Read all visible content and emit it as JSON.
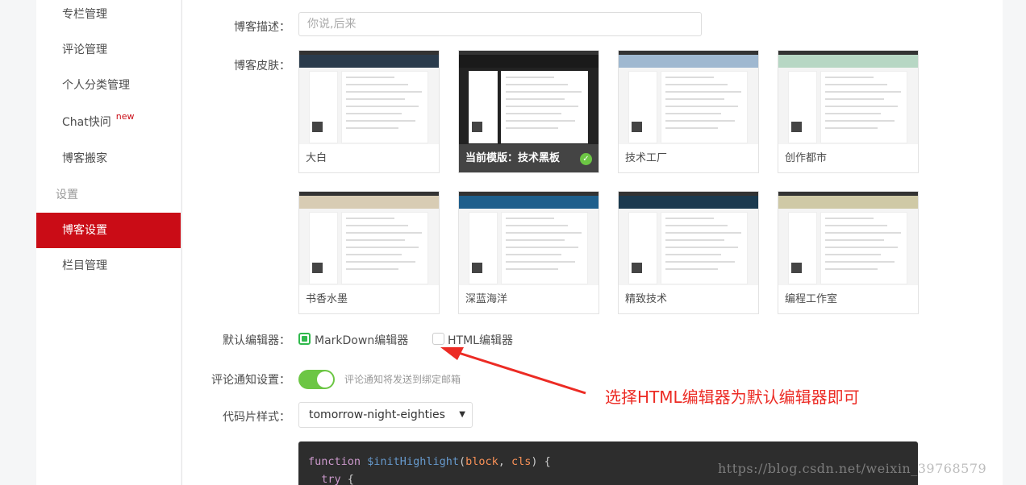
{
  "sidebar": {
    "items": [
      {
        "label": "专栏管理"
      },
      {
        "label": "评论管理"
      },
      {
        "label": "个人分类管理"
      },
      {
        "label": "Chat快问",
        "badge": "new"
      },
      {
        "label": "博客搬家"
      }
    ],
    "settings_heading": "设置",
    "settings_items": [
      {
        "label": "博客设置",
        "active": true
      },
      {
        "label": "栏目管理"
      }
    ]
  },
  "form": {
    "desc_label": "博客描述：",
    "desc_placeholder": "你说,后来",
    "skin_label": "博客皮肤：",
    "skins": [
      {
        "name": "大白",
        "banner": "#2a3b4c"
      },
      {
        "name": "当前模版：技术黑板",
        "banner": "#1a1a1a",
        "current": true
      },
      {
        "name": "技术工厂",
        "banner": "#9fb8d0"
      },
      {
        "name": "创作都市",
        "banner": "#b7d7c4"
      },
      {
        "name": "书香水墨",
        "banner": "#d8ccb4"
      },
      {
        "name": "深蓝海洋",
        "banner": "#1e5f8c"
      },
      {
        "name": "精致技术",
        "banner": "#1b3a4f"
      },
      {
        "name": "编程工作室",
        "banner": "#cfc9a6"
      }
    ],
    "editor_label": "默认编辑器：",
    "editor_markdown": "MarkDown编辑器",
    "editor_html": "HTML编辑器",
    "comment_label": "评论通知设置：",
    "comment_hint": "评论通知将发送到绑定邮箱",
    "code_style_label": "代码片样式：",
    "code_style_value": "tomorrow-night-eighties"
  },
  "code": {
    "line1_kw": "function",
    "line1_fn": "$initHighlight",
    "line1_p1": "block",
    "line1_p2": "cls",
    "line2_kw": "try"
  },
  "annotation": "选择HTML编辑器为默认编辑器即可",
  "watermark": "https://blog.csdn.net/weixin_39768579",
  "colors": {
    "accent": "#ca0c16",
    "green": "#6cc644",
    "annotation": "#ec2b24"
  }
}
